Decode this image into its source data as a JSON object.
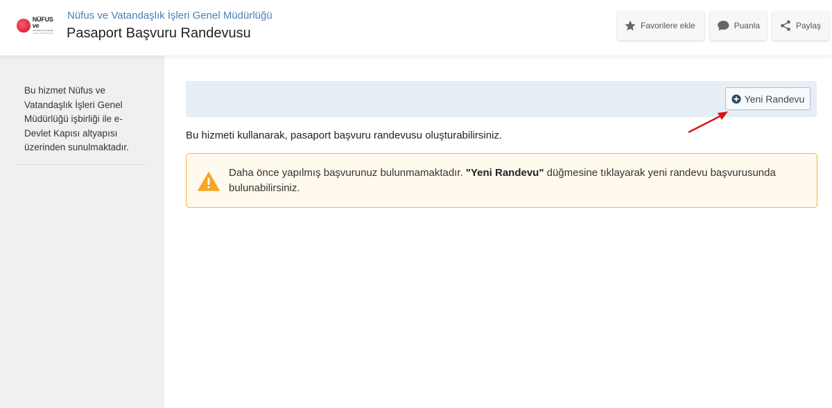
{
  "header": {
    "logo": {
      "line1": "NÜFUS ve",
      "line2": "VATANDAŞLIK İŞLERİ",
      "line3": "GENEL MÜDÜRLÜĞÜ"
    },
    "org_name": "Nüfus ve Vatandaşlık İşleri Genel Müdürlüğü",
    "page_title": "Pasaport Başvuru Randevusu",
    "buttons": {
      "favorite": "Favorilere ekle",
      "rate": "Puanla",
      "share": "Paylaş"
    }
  },
  "sidebar": {
    "info": "Bu hizmet Nüfus ve Vatandaşlık İşleri Genel Müdürlüğü işbirliği ile e-Devlet Kapısı altyapısı üzerinden sunulmaktadır."
  },
  "main": {
    "new_appointment_button": "Yeni Randevu",
    "description": "Bu hizmeti kullanarak, pasaport başvuru randevusu oluşturabilirsiniz.",
    "alert": {
      "part1": "Daha önce yapılmış başvurunuz bulunmamaktadır. ",
      "highlight": "\"Yeni Randevu\"",
      "part2": " düğmesine tıklayarak yeni randevu başvurusunda bulunabilirsiniz."
    }
  },
  "colors": {
    "link_blue": "#4a7fb5",
    "alert_border": "#f0b43c",
    "alert_icon": "#f5a623",
    "annotation_arrow": "#e01010",
    "logo_red": "#c8102e"
  }
}
